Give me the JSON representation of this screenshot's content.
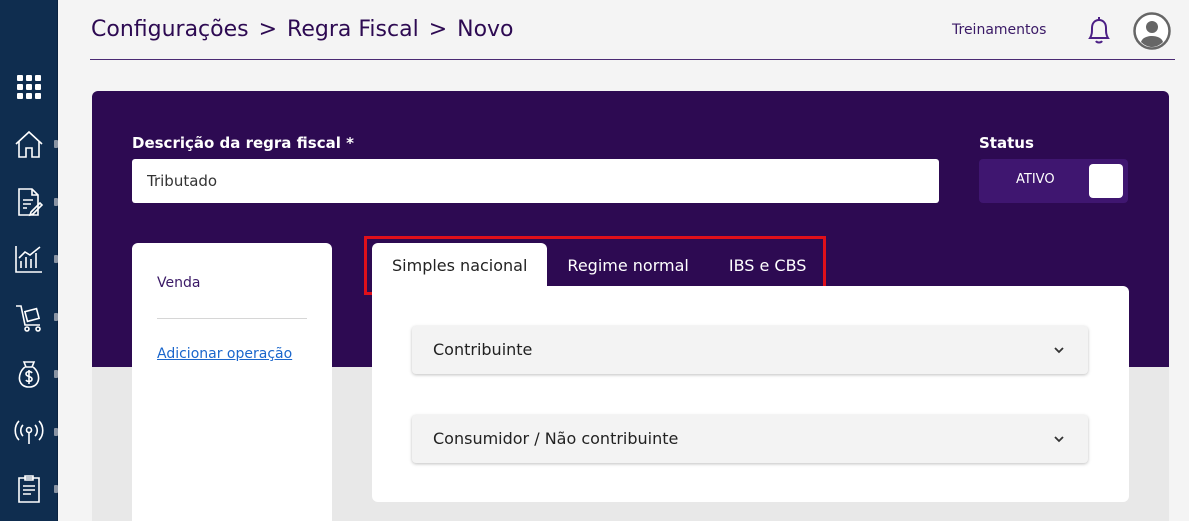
{
  "breadcrumb": {
    "items": [
      "Configurações",
      "Regra Fiscal",
      "Novo"
    ],
    "separator": ">"
  },
  "header": {
    "treinamentos_label": "Treinamentos"
  },
  "form": {
    "description_label": "Descrição da regra fiscal *",
    "description_value": "Tributado",
    "status_label": "Status",
    "status_toggle_text": "ATIVO"
  },
  "operations": {
    "items": [
      "Venda"
    ],
    "add_label": "Adicionar operação"
  },
  "tabs": [
    {
      "label": "Simples nacional",
      "active": true
    },
    {
      "label": "Regime normal",
      "active": false
    },
    {
      "label": "IBS e CBS",
      "active": false
    }
  ],
  "accordions": [
    {
      "title": "Contribuinte"
    },
    {
      "title": "Consumidor / Não contribuinte"
    }
  ],
  "sidebar": {
    "items": [
      "apps-grid-icon",
      "home-icon",
      "document-edit-icon",
      "chart-icon",
      "cart-icon",
      "money-bag-icon",
      "broadcast-icon",
      "report-icon"
    ]
  },
  "colors": {
    "primary_purple": "#2d0a52",
    "sidebar_navy": "#0f2d4f",
    "highlight_red": "#e0101a",
    "link_blue": "#1a66cc"
  }
}
